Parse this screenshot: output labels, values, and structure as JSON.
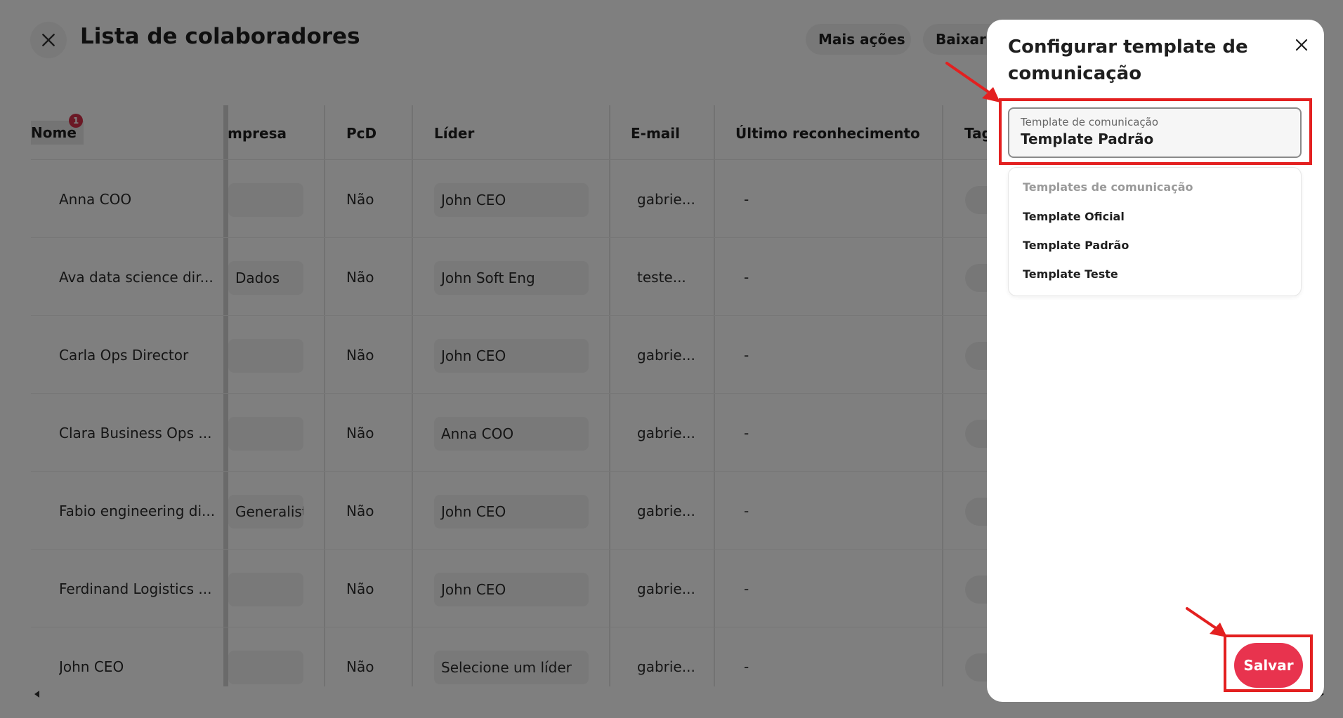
{
  "header": {
    "title": "Lista de colaboradores",
    "more_actions": "Mais ações",
    "download": "Baixar c"
  },
  "table": {
    "columns": {
      "nome": "Nome",
      "nome_badge": "1",
      "empresa": "mpresa",
      "pcd": "PcD",
      "lider": "Líder",
      "email": "E-mail",
      "ultimo": "Último reconhecimento",
      "tag": "Tag"
    },
    "rows": [
      {
        "nome": "Anna COO",
        "empresa": "",
        "pcd": "Não",
        "lider": "John CEO",
        "email": "gabrie...",
        "ultimo": "-"
      },
      {
        "nome": "Ava data science dir...",
        "empresa": "Dados",
        "pcd": "Não",
        "lider": "John Soft Eng",
        "email": "teste...",
        "ultimo": "-"
      },
      {
        "nome": "Carla Ops Director",
        "empresa": "",
        "pcd": "Não",
        "lider": "John CEO",
        "email": "gabrie...",
        "ultimo": "-"
      },
      {
        "nome": "Clara Business Ops ...",
        "empresa": "",
        "pcd": "Não",
        "lider": "Anna COO",
        "email": "gabrie...",
        "ultimo": "-"
      },
      {
        "nome": "Fabio engineering di...",
        "empresa": "Generalista",
        "pcd": "Não",
        "lider": "John CEO",
        "email": "gabrie...",
        "ultimo": "-"
      },
      {
        "nome": "Ferdinand Logistics ...",
        "empresa": "",
        "pcd": "Não",
        "lider": "John CEO",
        "email": "gabrie...",
        "ultimo": "-"
      },
      {
        "nome": "John CEO",
        "empresa": "",
        "pcd": "Não",
        "lider": "Selecione um líder",
        "email": "gabrie...",
        "ultimo": "-"
      }
    ]
  },
  "drawer": {
    "title": "Configurar template de comunicação",
    "field_label": "Template de comunicação",
    "field_value": "Template Padrão",
    "menu_header": "Templates de comunicação",
    "options": [
      "Template Oficial",
      "Template Padrão",
      "Template Teste"
    ],
    "save": "Salvar"
  },
  "colors": {
    "accent": "#e8334e",
    "annotation": "#e32020",
    "badge": "#d6314a"
  },
  "icons": [
    "close-icon",
    "chevron-left-icon",
    "chevron-right-icon",
    "arrow-annotation-icon"
  ]
}
